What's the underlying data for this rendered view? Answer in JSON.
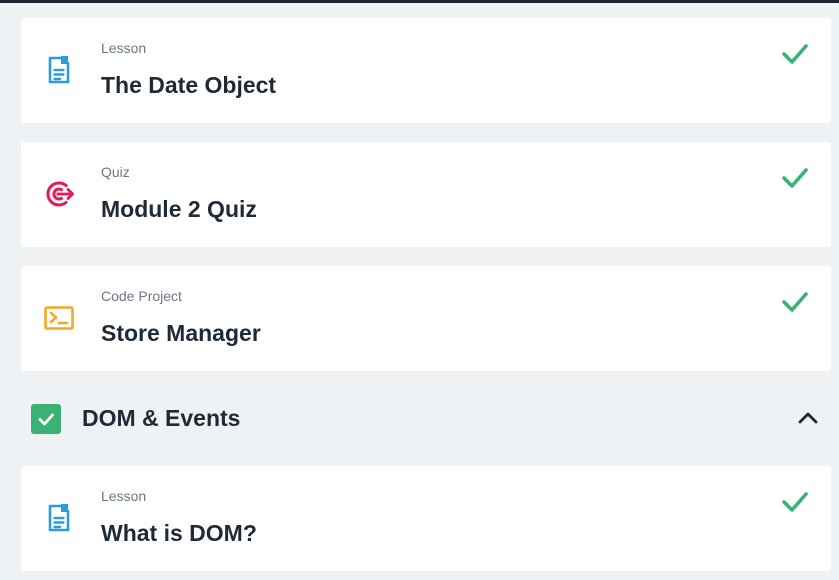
{
  "items": [
    {
      "type": "Lesson",
      "title": "The Date Object",
      "icon": "lesson-icon",
      "completed": true
    },
    {
      "type": "Quiz",
      "title": "Module 2 Quiz",
      "icon": "quiz-target-icon",
      "completed": true
    },
    {
      "type": "Code Project",
      "title": "Store Manager",
      "icon": "code-project-icon",
      "completed": true
    }
  ],
  "section": {
    "title": "DOM & Events",
    "completed": true,
    "expanded": true
  },
  "section_items": [
    {
      "type": "Lesson",
      "title": "What is DOM?",
      "icon": "lesson-icon",
      "completed": true
    }
  ],
  "colors": {
    "background": "#eef2f5",
    "check_green": "#3bb273",
    "lesson_blue": "#2d9cdb",
    "quiz_pink": "#e8185c",
    "code_orange": "#f5a623",
    "title_text": "#1f2a37",
    "type_text": "#6b7785"
  }
}
